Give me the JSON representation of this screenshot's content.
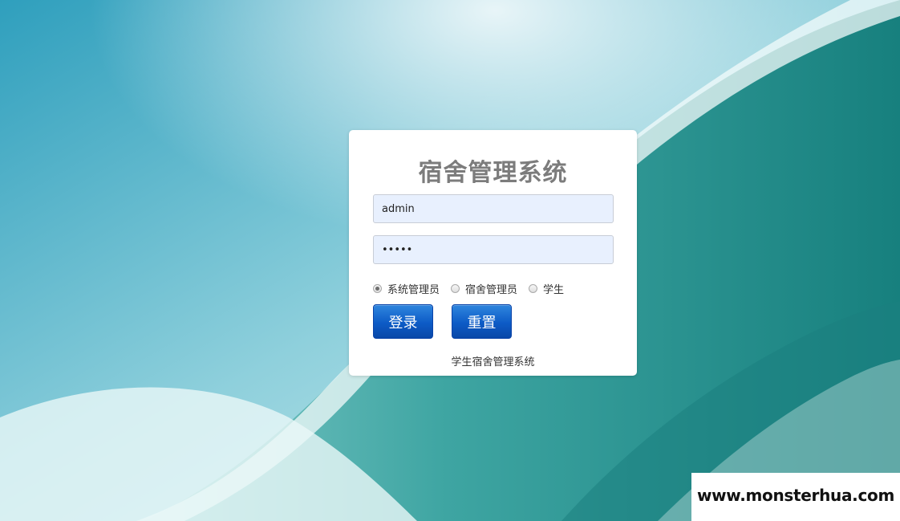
{
  "login": {
    "title": "宿舍管理系统",
    "username_value": "admin",
    "password_value": "•••••",
    "roles": [
      {
        "label": "系统管理员",
        "checked": true
      },
      {
        "label": "宿舍管理员",
        "checked": false
      },
      {
        "label": "学生",
        "checked": false
      }
    ],
    "login_button": "登录",
    "reset_button": "重置",
    "footer": "学生宿舍管理系统"
  },
  "watermark": {
    "text": "www.monsterhua.com"
  },
  "colors": {
    "button_blue": "#0d5bc6",
    "title_gray": "#7c7c7c",
    "input_fill": "#e8f0fe"
  }
}
